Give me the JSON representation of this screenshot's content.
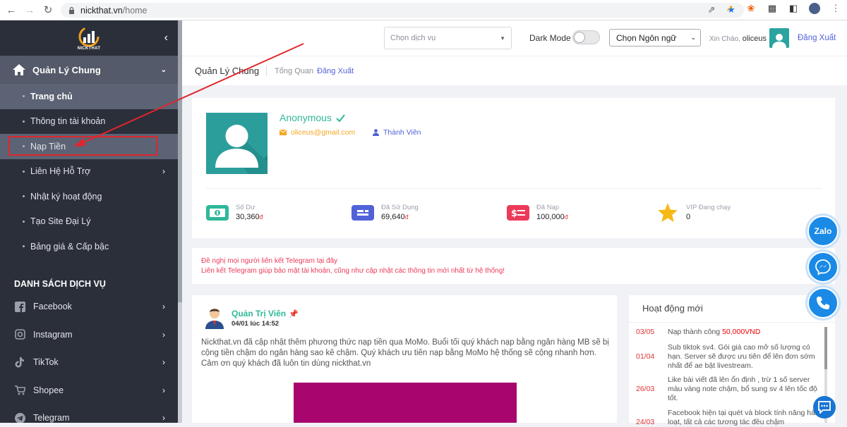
{
  "browser": {
    "url_host": "nickthat.vn",
    "url_path": "/home"
  },
  "sidebar": {
    "logo_text": "NICKTHAT",
    "group_title": "Quản Lý Chung",
    "items": [
      {
        "label": "Trang chủ"
      },
      {
        "label": "Thông tin tài khoản"
      },
      {
        "label": "Nạp Tiền"
      },
      {
        "label": "Liên Hệ Hỗ Trợ"
      },
      {
        "label": "Nhật ký hoạt động"
      },
      {
        "label": "Tạo Site Đại Lý"
      },
      {
        "label": "Bảng giá & Cấp bậc"
      }
    ],
    "services_title": "DANH SÁCH DỊCH VỤ",
    "services": [
      {
        "label": "Facebook",
        "icon": "facebook-icon"
      },
      {
        "label": "Instagram",
        "icon": "instagram-icon"
      },
      {
        "label": "TikTok",
        "icon": "tiktok-icon"
      },
      {
        "label": "Shopee",
        "icon": "shopee-icon"
      },
      {
        "label": "Telegram",
        "icon": "telegram-icon"
      }
    ]
  },
  "header": {
    "service_placeholder": "Chọn dịch vụ",
    "dark_mode_label": "Dark Mode",
    "language_label": "Chọn Ngôn ngữ",
    "greeting": "Xin Chào,",
    "username": "oliceus",
    "logout": "Đăng Xuất"
  },
  "breadcrumb": {
    "title": "Quản Lý Chung",
    "sub": "Tổng Quan",
    "logout": "Đăng Xuất"
  },
  "profile": {
    "name": "Anonymous",
    "email": "oliceus@gmail.com",
    "role": "Thành Viên",
    "stats": [
      {
        "label": "Số Dư",
        "value": "30,360",
        "currency": "đ",
        "icon": "money-icon",
        "color": "#2fb89a"
      },
      {
        "label": "Đã Sử Dụng",
        "value": "69,640",
        "currency": "đ",
        "icon": "card-icon",
        "color": "#5162d8"
      },
      {
        "label": "Đã Nạp",
        "value": "100,000",
        "currency": "đ",
        "icon": "dollar-icon",
        "color": "#ec3a5a"
      },
      {
        "label": "VIP Đang chạy",
        "value": "0",
        "currency": "",
        "icon": "star-icon",
        "color": "#f5b916"
      }
    ]
  },
  "notice": {
    "line1": "Đề nghị mọi người liên kết Telegram tại đây",
    "line2": "Liên kết Telegram giúp bảo mật tài khoản, cũng như cập nhật các thông tin mới nhất từ hệ thống!"
  },
  "post": {
    "author": "Quản Trị Viên",
    "date": "04/01 lúc 14:52",
    "body": "Nickthat.vn đã cập nhật thêm phương thức nạp tiền qua MoMo. Buổi tối quý khách nạp bằng ngân hàng MB sẽ bị cộng tiền chậm do ngân hàng sao kê chậm. Quý khách ưu tiên nạp bằng MoMo hệ thống sẽ cộng nhanh hơn. Cảm ơn quý khách đã luôn tin dùng nickthat.vn"
  },
  "activity": {
    "title": "Hoạt động mới",
    "rows": [
      {
        "date": "03/05",
        "text": "Nạp thành công ",
        "money": "50,000VND"
      },
      {
        "date": "01/04",
        "text": "Sub tiktok sv4. Gói giá cao mở số lượng có hạn. Server sẽ được ưu tiên để lên đơn sớm nhất để ae bật livestream.",
        "money": ""
      },
      {
        "date": "26/03",
        "text": "Like bài viết đã lên ổn định , trừ 1 số server màu vàng note chậm, bổ sung sv 4 lên tốc độ tốt.",
        "money": ""
      },
      {
        "date": "24/03",
        "text": "Facebook hiện tại quét và block tính năng hàng loạt, tất cả các tương tác đều chậm",
        "money": ""
      }
    ]
  },
  "floating": {
    "zalo": "Zalo"
  },
  "colors": {
    "sidebar_bg": "#2b2f3a",
    "accent_green": "#2fb89a",
    "accent_blue": "#5162d8",
    "annotation_red": "#e0262d"
  }
}
